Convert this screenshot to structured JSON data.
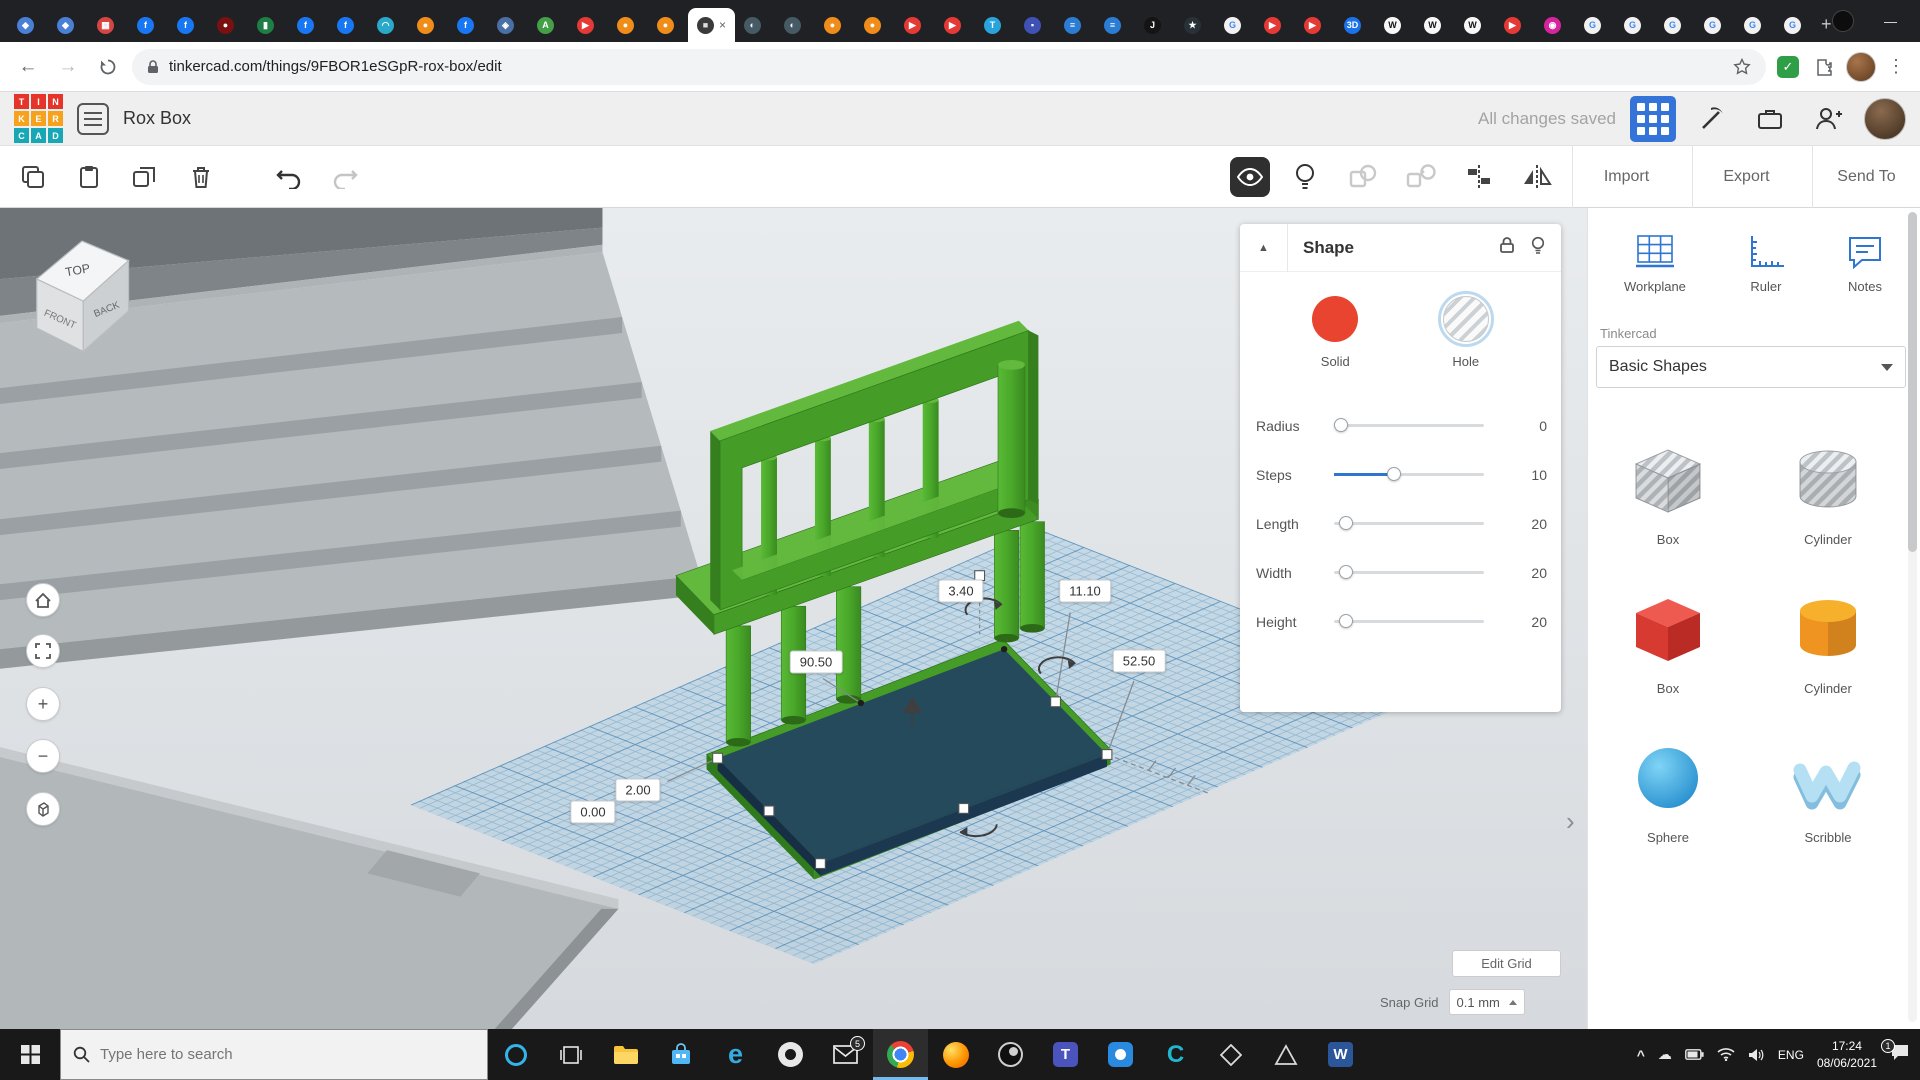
{
  "browser": {
    "tabs": [
      {
        "g": "◆",
        "c": "#4a7fd6"
      },
      {
        "g": "◆",
        "c": "#4a7fd6"
      },
      {
        "g": "▦",
        "c": "#d64541"
      },
      {
        "g": "f",
        "c": "#1877f2"
      },
      {
        "g": "f",
        "c": "#1877f2"
      },
      {
        "g": "●",
        "c": "#7a1010"
      },
      {
        "g": "▮",
        "c": "#1e7e45"
      },
      {
        "g": "f",
        "c": "#1877f2"
      },
      {
        "g": "f",
        "c": "#1877f2"
      },
      {
        "g": "◠",
        "c": "#2aa9c9"
      },
      {
        "g": "●",
        "c": "#f08c1a"
      },
      {
        "g": "f",
        "c": "#1877f2"
      },
      {
        "g": "◈",
        "c": "#4a6fa5"
      },
      {
        "g": "A",
        "c": "#43a047"
      },
      {
        "g": "▶",
        "c": "#e53935"
      },
      {
        "g": "●",
        "c": "#f08c1a"
      },
      {
        "g": "●",
        "c": "#f08c1a"
      },
      {
        "g": "■",
        "c": "#3a3a3a",
        "fg": "#dddddd",
        "bg": "#ffffff",
        "close": "×"
      },
      {
        "g": "◐",
        "c": "#455a64"
      },
      {
        "g": "◐",
        "c": "#455a64"
      },
      {
        "g": "●",
        "c": "#f08c1a"
      },
      {
        "g": "●",
        "c": "#f08c1a"
      },
      {
        "g": "▶",
        "c": "#e53935"
      },
      {
        "g": "▶",
        "c": "#e53935"
      },
      {
        "g": "T",
        "c": "#29a3dc"
      },
      {
        "g": "▪",
        "c": "#3f51b5"
      },
      {
        "g": "≡",
        "c": "#2b7cd3"
      },
      {
        "g": "≡",
        "c": "#2b7cd3"
      },
      {
        "g": "J",
        "c": "#141414"
      },
      {
        "g": "★",
        "c": "#263238"
      },
      {
        "g": "G",
        "c": "#f1f1f1",
        "fg": "#4285f4"
      },
      {
        "g": "▶",
        "c": "#e53935"
      },
      {
        "g": "▶",
        "c": "#e53935"
      },
      {
        "g": "3D",
        "c": "#1a73e8"
      },
      {
        "g": "W",
        "c": "#f7f7f7",
        "fg": "#111111"
      },
      {
        "g": "W",
        "c": "#f7f7f7",
        "fg": "#111111"
      },
      {
        "g": "W",
        "c": "#f7f7f7",
        "fg": "#111111"
      },
      {
        "g": "▶",
        "c": "#e53935"
      },
      {
        "g": "◉",
        "c": "#d6249f"
      },
      {
        "g": "G",
        "c": "#f1f1f1",
        "fg": "#4285f4"
      },
      {
        "g": "G",
        "c": "#f1f1f1",
        "fg": "#4285f4"
      },
      {
        "g": "G",
        "c": "#f1f1f1",
        "fg": "#4285f4"
      },
      {
        "g": "G",
        "c": "#f1f1f1",
        "fg": "#4285f4"
      },
      {
        "g": "G",
        "c": "#f1f1f1",
        "fg": "#4285f4"
      },
      {
        "g": "G",
        "c": "#f1f1f1",
        "fg": "#4285f4"
      }
    ],
    "new_tab": "+",
    "titlebar": {
      "minimize": "—",
      "maximize": "□",
      "close": "×"
    },
    "nav_back": "←",
    "nav_forward": "→",
    "url": "tinkercad.com/things/9FBOR1eSGpR-rox-box/edit"
  },
  "header": {
    "logo": [
      {
        "ch": "T",
        "c": "#e5352b"
      },
      {
        "ch": "I",
        "c": "#e5352b"
      },
      {
        "ch": "N",
        "c": "#e5352b"
      },
      {
        "ch": "K",
        "c": "#f6a21d"
      },
      {
        "ch": "E",
        "c": "#f6a21d"
      },
      {
        "ch": "R",
        "c": "#f6a21d"
      },
      {
        "ch": "C",
        "c": "#18a7b5"
      },
      {
        "ch": "A",
        "c": "#18a7b5"
      },
      {
        "ch": "D",
        "c": "#18a7b5"
      }
    ],
    "title": "Rox Box",
    "status": "All changes saved"
  },
  "toolbar": {
    "import": "Import",
    "export": "Export",
    "send_to": "Send To"
  },
  "viewport": {
    "view_cube": {
      "top": "TOP",
      "front": "FRONT",
      "back": "BACK"
    },
    "dims": [
      "3.40",
      "11.10",
      "90.50",
      "52.50",
      "2.00",
      "0.00"
    ],
    "edit_grid": "Edit Grid",
    "snap_grid_label": "Snap Grid",
    "snap_grid_value": "0.1 mm",
    "panel_chevron": "›"
  },
  "shape_panel": {
    "title": "Shape",
    "collapse": "▲",
    "materials": [
      {
        "label": "Solid"
      },
      {
        "label": "Hole"
      }
    ],
    "sliders": [
      {
        "label": "Radius",
        "value": "0",
        "knob": 2,
        "fill": 0
      },
      {
        "label": "Steps",
        "value": "10",
        "knob": 40,
        "fill": 40
      },
      {
        "label": "Length",
        "value": "20",
        "knob": 8,
        "fill": 0
      },
      {
        "label": "Width",
        "value": "20",
        "knob": 8,
        "fill": 0
      },
      {
        "label": "Height",
        "value": "20",
        "knob": 8,
        "fill": 0
      }
    ]
  },
  "sidebar": {
    "tools": [
      {
        "label": "Workplane"
      },
      {
        "label": "Ruler"
      },
      {
        "label": "Notes"
      }
    ],
    "library_label": "Tinkercad",
    "library_value": "Basic Shapes",
    "shapes": [
      {
        "label": "Box"
      },
      {
        "label": "Cylinder"
      },
      {
        "label": "Box"
      },
      {
        "label": "Cylinder"
      },
      {
        "label": "Sphere"
      },
      {
        "label": "Scribble"
      }
    ]
  },
  "taskbar": {
    "search_placeholder": "Type here to search",
    "mail_badge": "5",
    "tray": {
      "lang": "ENG",
      "time": "17:24",
      "date": "08/06/2021",
      "notif_badge": "1"
    }
  },
  "colors": {
    "accent_blue": "#3473d8",
    "selection_navy": "#24465f",
    "structure_green": "#459d28",
    "workplane_blue": "#7db9e0"
  }
}
